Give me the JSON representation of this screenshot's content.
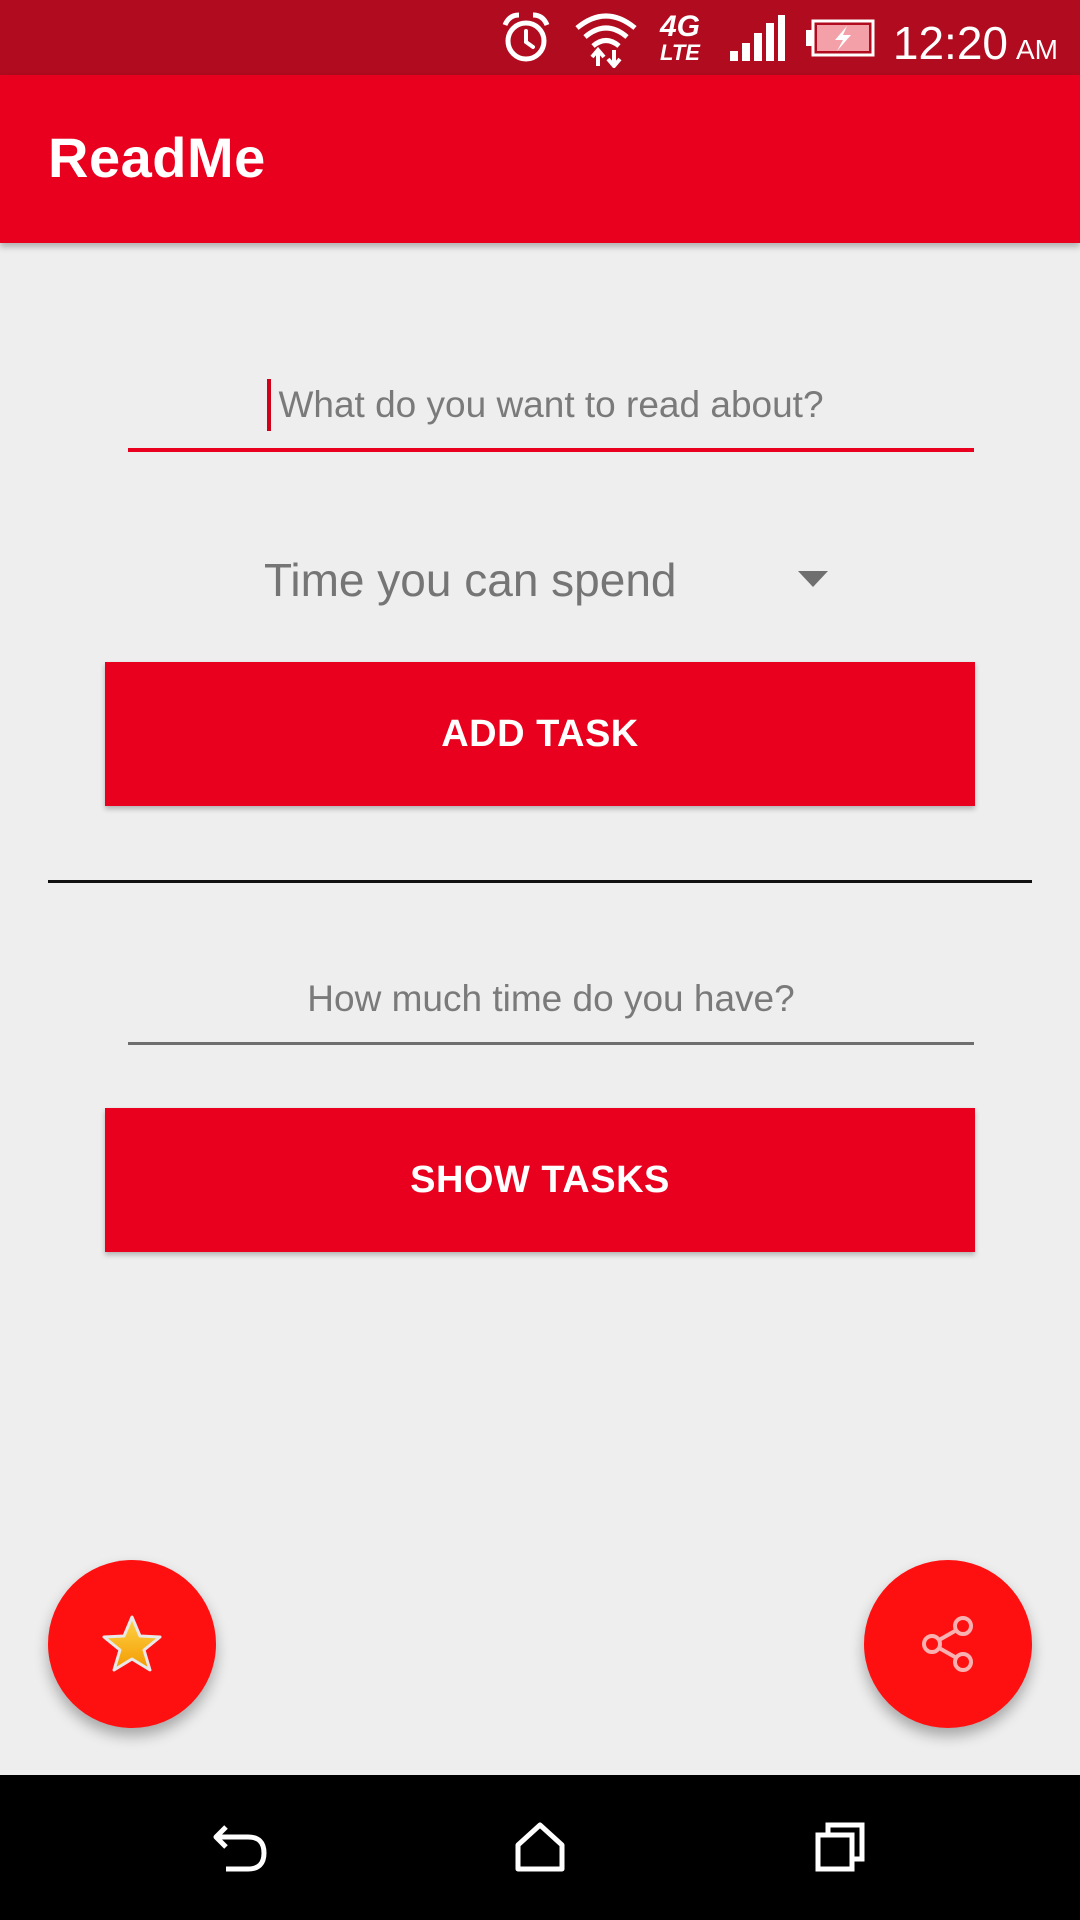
{
  "status_bar": {
    "time": "12:20",
    "ampm": "AM",
    "network_label": "4G",
    "network_sub": "LTE",
    "icons": [
      "alarm-icon",
      "wifi-icon",
      "lte-icon",
      "signal-icon",
      "battery-charging-icon"
    ]
  },
  "app_bar": {
    "title": "ReadMe"
  },
  "form": {
    "topic_placeholder": "What do you want to read about?",
    "topic_value": "",
    "time_spinner_label": "Time you can spend",
    "add_button": "ADD TASK",
    "available_time_placeholder": "How much time do you have?",
    "available_time_value": "",
    "show_button": "SHOW TASKS"
  },
  "fabs": {
    "left_icon": "star-icon",
    "right_icon": "share-icon"
  },
  "nav_bar": {
    "icons": [
      "back-icon",
      "home-icon",
      "recents-icon"
    ]
  },
  "colors": {
    "primary": "#e8001e",
    "primary_dark": "#b00b1e",
    "fab": "#ff1010",
    "background": "#eeeeee"
  }
}
